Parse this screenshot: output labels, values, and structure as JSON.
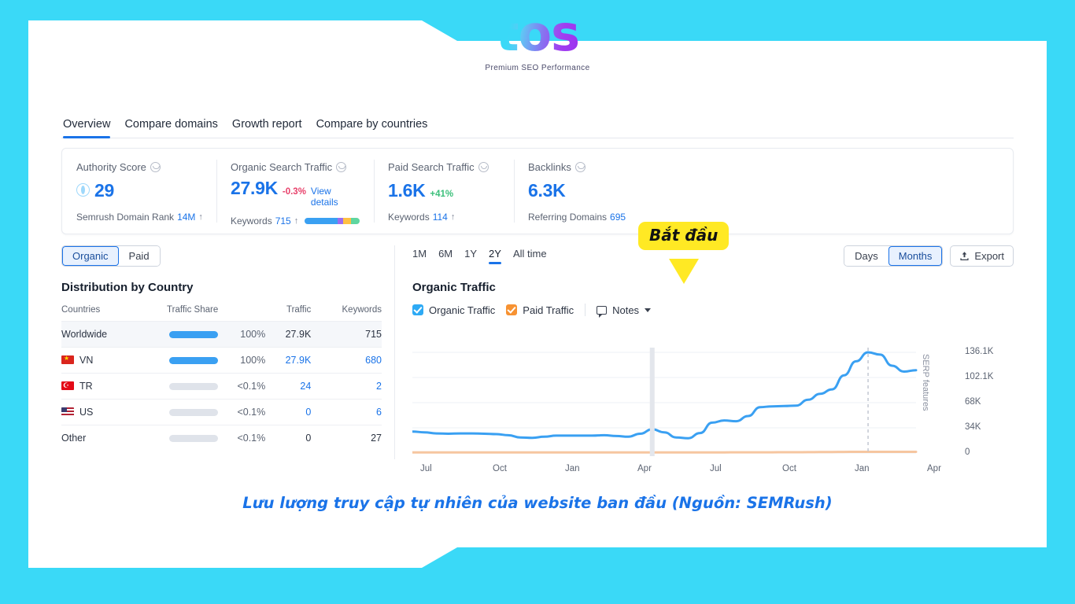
{
  "brand": {
    "mark": "tos",
    "tagline": "Premium SEO Performance"
  },
  "tabs": [
    {
      "label": "Overview",
      "active": true
    },
    {
      "label": "Compare domains",
      "active": false
    },
    {
      "label": "Growth report",
      "active": false
    },
    {
      "label": "Compare by countries",
      "active": false
    }
  ],
  "metrics": [
    {
      "title": "Authority Score",
      "value": "29",
      "delta": "",
      "link": "",
      "foot_label": "Semrush Domain Rank",
      "foot_value": "14M",
      "foot_arrow": "↑"
    },
    {
      "title": "Organic Search Traffic",
      "value": "27.9K",
      "delta": "-0.3%",
      "delta_sign": "neg",
      "link": "View details",
      "foot_label": "Keywords",
      "foot_value": "715",
      "foot_arrow": "↑"
    },
    {
      "title": "Paid Search Traffic",
      "value": "1.6K",
      "delta": "+41%",
      "delta_sign": "pos",
      "link": "",
      "foot_label": "Keywords",
      "foot_value": "114",
      "foot_arrow": "↑"
    },
    {
      "title": "Backlinks",
      "value": "6.3K",
      "delta": "",
      "link": "",
      "foot_label": "Referring Domains",
      "foot_value": "695",
      "foot_arrow": ""
    }
  ],
  "keyword_bar_colors": [
    "#3aa0f2",
    "#9b6cf0",
    "#ffc043",
    "#5fd6a0"
  ],
  "traffic_toggle": {
    "options": [
      "Organic",
      "Paid"
    ],
    "selected": "Organic"
  },
  "country_panel": {
    "title": "Distribution by Country",
    "columns": [
      "Countries",
      "Traffic Share",
      "Traffic",
      "Keywords"
    ],
    "rows": [
      {
        "country": "Worldwide",
        "flag": "",
        "share_bar": "full",
        "share": "100%",
        "traffic": "27.9K",
        "keywords": "715",
        "highlight": true,
        "traffic_link": false,
        "keywords_link": false
      },
      {
        "country": "VN",
        "flag": "vn",
        "share_bar": "full",
        "share": "100%",
        "traffic": "27.9K",
        "keywords": "680",
        "highlight": false,
        "traffic_link": true,
        "keywords_link": true
      },
      {
        "country": "TR",
        "flag": "tr",
        "share_bar": "tiny",
        "share": "<0.1%",
        "traffic": "24",
        "keywords": "2",
        "highlight": false,
        "traffic_link": true,
        "keywords_link": true
      },
      {
        "country": "US",
        "flag": "us",
        "share_bar": "tiny",
        "share": "<0.1%",
        "traffic": "0",
        "keywords": "6",
        "highlight": false,
        "traffic_link": true,
        "keywords_link": true
      },
      {
        "country": "Other",
        "flag": "",
        "share_bar": "tiny",
        "share": "<0.1%",
        "traffic": "0",
        "keywords": "27",
        "highlight": false,
        "traffic_link": false,
        "keywords_link": false
      }
    ]
  },
  "chart_panel": {
    "ranges": [
      "1M",
      "6M",
      "1Y",
      "2Y",
      "All time"
    ],
    "selected_range": "2Y",
    "granularity": {
      "options": [
        "Days",
        "Months"
      ],
      "selected": "Months"
    },
    "export_label": "Export",
    "title": "Organic Traffic",
    "legend": [
      {
        "label": "Organic Traffic",
        "color": "#2eaaf5",
        "checked": true
      },
      {
        "label": "Paid Traffic",
        "color": "#f79232",
        "checked": true
      }
    ],
    "notes_label": "Notes",
    "serp_marker_label": "SERP features"
  },
  "annotation": {
    "text": "Bắt đầu",
    "color": "#ffe924"
  },
  "caption": {
    "text": "Lưu lượng truy cập tự nhiên của website ban đầu (Nguồn: SEMRush)"
  },
  "chart_data": {
    "type": "line",
    "title": "Organic Traffic",
    "xlabel": "",
    "ylabel": "",
    "ylim": [
      0,
      136100
    ],
    "ytick_labels": [
      "136.1K",
      "102.1K",
      "68K",
      "34K",
      "0"
    ],
    "ytick_values": [
      136100,
      102100,
      68000,
      34000,
      0
    ],
    "xtick_labels": [
      "Jul",
      "Oct",
      "Jan",
      "Apr",
      "Jul",
      "Oct",
      "Jan",
      "Apr"
    ],
    "grid": true,
    "legend_position": "top-left",
    "series": [
      {
        "name": "Organic Traffic",
        "color": "#3aa0f2",
        "values": [
          29000,
          28000,
          26500,
          26000,
          26500,
          26500,
          26000,
          25500,
          24000,
          21000,
          20500,
          22000,
          23500,
          23500,
          23500,
          23500,
          24000,
          23000,
          22000,
          26000,
          32000,
          28000,
          21000,
          20000,
          27000,
          41000,
          44000,
          43000,
          50000,
          62000,
          63000,
          63500,
          64000,
          72000,
          80000,
          86000,
          105000,
          124000,
          136100,
          133000,
          118000,
          110000,
          112000
        ]
      },
      {
        "name": "Paid Traffic",
        "color": "#f6c6a0",
        "values": [
          900,
          900,
          900,
          900,
          900,
          900,
          900,
          900,
          900,
          900,
          900,
          900,
          900,
          900,
          900,
          900,
          900,
          900,
          900,
          900,
          900,
          900,
          900,
          900,
          900,
          900,
          900,
          1000,
          1000,
          1000,
          1000,
          1100,
          1100,
          1200,
          1300,
          1400,
          1500,
          1600,
          1600,
          1600,
          1600,
          1600,
          1600
        ]
      }
    ],
    "markers": [
      {
        "type": "vertical-band",
        "label": "",
        "x_index": 20
      },
      {
        "type": "vertical-dashed",
        "label": "SERP features",
        "x_index": 38
      }
    ]
  }
}
